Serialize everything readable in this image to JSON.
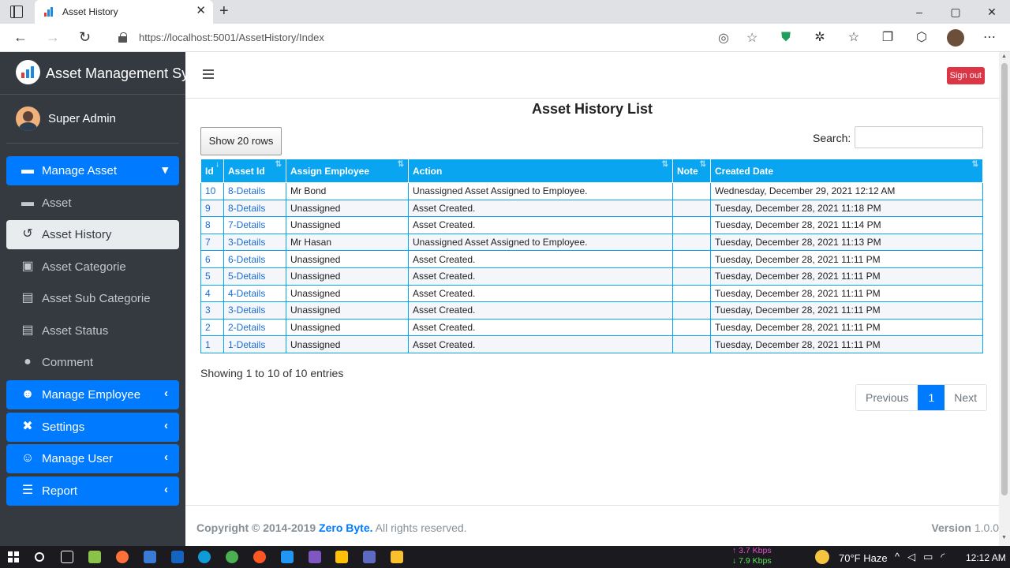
{
  "browser": {
    "tab_title": "Asset History",
    "url_host": "https://localhost",
    "url_path": ":5001/AssetHistory/Index",
    "window_controls": [
      "–",
      "▢",
      "✕"
    ]
  },
  "sidebar": {
    "brand": "Asset Management Sys",
    "user": "Super Admin",
    "items": [
      {
        "label": "Manage Asset",
        "icon": "box-icon",
        "caret": "▾"
      },
      {
        "label": "Asset",
        "icon": "folder-icon"
      },
      {
        "label": "Asset History",
        "icon": "history-icon"
      },
      {
        "label": "Asset Categorie",
        "icon": "category-icon"
      },
      {
        "label": "Asset Sub Categorie",
        "icon": "id-card-icon"
      },
      {
        "label": "Asset Status",
        "icon": "id-card-icon"
      },
      {
        "label": "Comment",
        "icon": "comment-icon"
      },
      {
        "label": "Manage Employee",
        "icon": "users-icon",
        "caret": "‹"
      },
      {
        "label": "Settings",
        "icon": "tools-icon",
        "caret": "‹"
      },
      {
        "label": "Manage User",
        "icon": "user-cog-icon",
        "caret": "‹"
      },
      {
        "label": "Report",
        "icon": "database-icon",
        "caret": "‹"
      }
    ]
  },
  "topnav": {
    "signout": "Sign out"
  },
  "content": {
    "title": "Asset History List",
    "show_rows": "Show 20 rows",
    "search_label": "Search:",
    "search_value": "",
    "columns": [
      "Id",
      "Asset Id",
      "Assign Employee",
      "Action",
      "Note",
      "Created Date"
    ],
    "rows": [
      [
        "10",
        "8-Details",
        "Mr Bond",
        "Unassigned Asset Assigned to Employee.",
        "",
        "Wednesday, December 29, 2021 12:12 AM"
      ],
      [
        "9",
        "8-Details",
        "Unassigned",
        "Asset Created.",
        "",
        "Tuesday, December 28, 2021 11:18 PM"
      ],
      [
        "8",
        "7-Details",
        "Unassigned",
        "Asset Created.",
        "",
        "Tuesday, December 28, 2021 11:14 PM"
      ],
      [
        "7",
        "3-Details",
        "Mr Hasan",
        "Unassigned Asset Assigned to Employee.",
        "",
        "Tuesday, December 28, 2021 11:13 PM"
      ],
      [
        "6",
        "6-Details",
        "Unassigned",
        "Asset Created.",
        "",
        "Tuesday, December 28, 2021 11:11 PM"
      ],
      [
        "5",
        "5-Details",
        "Unassigned",
        "Asset Created.",
        "",
        "Tuesday, December 28, 2021 11:11 PM"
      ],
      [
        "4",
        "4-Details",
        "Unassigned",
        "Asset Created.",
        "",
        "Tuesday, December 28, 2021 11:11 PM"
      ],
      [
        "3",
        "3-Details",
        "Unassigned",
        "Asset Created.",
        "",
        "Tuesday, December 28, 2021 11:11 PM"
      ],
      [
        "2",
        "2-Details",
        "Unassigned",
        "Asset Created.",
        "",
        "Tuesday, December 28, 2021 11:11 PM"
      ],
      [
        "1",
        "1-Details",
        "Unassigned",
        "Asset Created.",
        "",
        "Tuesday, December 28, 2021 11:11 PM"
      ]
    ],
    "info": "Showing 1 to 10 of 10 entries",
    "pager": {
      "prev": "Previous",
      "current": "1",
      "next": "Next"
    }
  },
  "footer": {
    "copyright": "Copyright © 2014-2019",
    "company": "Zero Byte.",
    "rights": "All rights reserved.",
    "version_label": "Version",
    "version": "1.0.0"
  },
  "taskbar": {
    "net_up": "↑ 3.7 Kbps",
    "net_down": "↓ 7.9 Kbps",
    "weather": "70°F  Haze",
    "time": "12:12 AM"
  },
  "colors": {
    "accent": "#007bff",
    "table_header": "#0aa5f0",
    "sidebar": "#343a40",
    "signout": "#dc3545"
  }
}
